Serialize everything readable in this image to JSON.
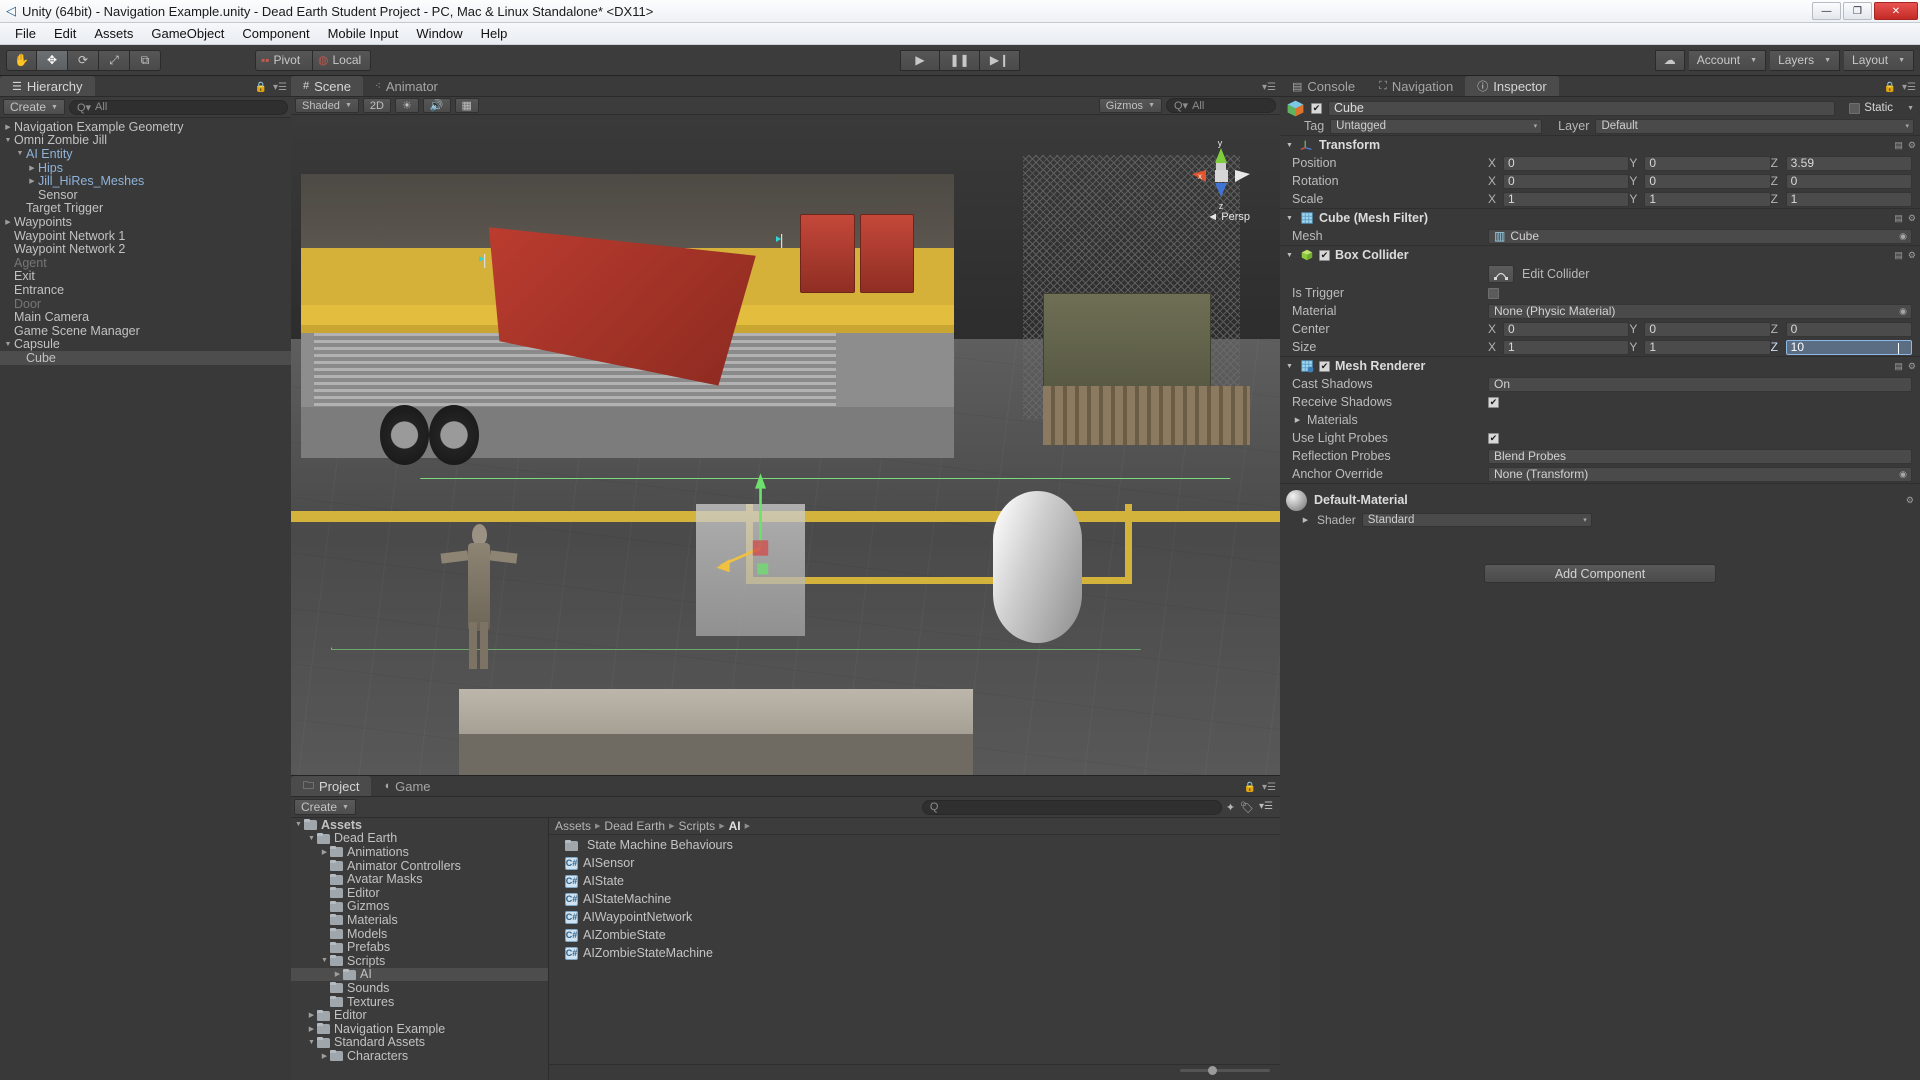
{
  "window": {
    "title": "Unity (64bit) - Navigation Example.unity - Dead Earth Student Project - PC, Mac & Linux Standalone* <DX11>",
    "app_icon": "unity-icon",
    "buttons": {
      "minimize": "—",
      "maximize": "❐",
      "close": "✕"
    }
  },
  "menubar": {
    "items": [
      "File",
      "Edit",
      "Assets",
      "GameObject",
      "Component",
      "Mobile Input",
      "Window",
      "Help"
    ]
  },
  "toolbar": {
    "tools": [
      {
        "name": "hand-tool",
        "glyph": "✋"
      },
      {
        "name": "move-tool",
        "glyph": "✥"
      },
      {
        "name": "rotate-tool",
        "glyph": "⟳"
      },
      {
        "name": "scale-tool",
        "glyph": "⤢"
      },
      {
        "name": "rect-tool",
        "glyph": "⧉"
      }
    ],
    "pivot_label": "Pivot",
    "local_label": "Local",
    "play_label": "▶",
    "pause_label": "❚❚",
    "step_label": "▶❙",
    "cloud_label": "☁",
    "account_label": "Account",
    "layers_label": "Layers",
    "layout_label": "Layout"
  },
  "hierarchy": {
    "tab_label": "Hierarchy",
    "create_label": "Create",
    "search_placeholder": "All",
    "items": [
      {
        "label": "Navigation Example Geometry",
        "depth": 0,
        "arrow": "right",
        "style": "normal"
      },
      {
        "label": "Omni Zombie Jill",
        "depth": 0,
        "arrow": "down",
        "style": "normal"
      },
      {
        "label": "AI Entity",
        "depth": 1,
        "arrow": "down",
        "style": "prefab"
      },
      {
        "label": "Hips",
        "depth": 2,
        "arrow": "right",
        "style": "prefab"
      },
      {
        "label": "Jill_HiRes_Meshes",
        "depth": 2,
        "arrow": "right",
        "style": "prefab"
      },
      {
        "label": "Sensor",
        "depth": 2,
        "arrow": "none",
        "style": "normal"
      },
      {
        "label": "Target Trigger",
        "depth": 1,
        "arrow": "none",
        "style": "normal"
      },
      {
        "label": "Waypoints",
        "depth": 0,
        "arrow": "right",
        "style": "normal"
      },
      {
        "label": "Waypoint Network 1",
        "depth": 0,
        "arrow": "none",
        "style": "normal"
      },
      {
        "label": "Waypoint Network 2",
        "depth": 0,
        "arrow": "none",
        "style": "normal"
      },
      {
        "label": "Agent",
        "depth": 0,
        "arrow": "none",
        "style": "inactive"
      },
      {
        "label": "Exit",
        "depth": 0,
        "arrow": "none",
        "style": "normal"
      },
      {
        "label": "Entrance",
        "depth": 0,
        "arrow": "none",
        "style": "normal"
      },
      {
        "label": "Door",
        "depth": 0,
        "arrow": "none",
        "style": "inactive"
      },
      {
        "label": "Main Camera",
        "depth": 0,
        "arrow": "none",
        "style": "normal"
      },
      {
        "label": "Game Scene Manager",
        "depth": 0,
        "arrow": "none",
        "style": "normal"
      },
      {
        "label": "Capsule",
        "depth": 0,
        "arrow": "down",
        "style": "normal"
      },
      {
        "label": "Cube",
        "depth": 1,
        "arrow": "none",
        "style": "normal",
        "selected": true
      }
    ]
  },
  "scene": {
    "tabs": [
      {
        "label": "Scene",
        "icon": "scene-grid-icon",
        "active": true
      },
      {
        "label": "Animator",
        "icon": "animator-icon",
        "active": false
      }
    ],
    "shading_mode": "Shaded",
    "mode_2d": "2D",
    "light_icon": "☀",
    "audio_icon": "🔊",
    "fx_icon": "▦",
    "gizmos_label": "Gizmos",
    "search_placeholder": "All",
    "view_label": "Persp",
    "axis_labels": {
      "x": "x",
      "y": "y",
      "z": "z"
    }
  },
  "project": {
    "tabs": [
      {
        "label": "Project",
        "icon": "folder-icon",
        "active": true
      },
      {
        "label": "Game",
        "icon": "game-icon",
        "active": false
      }
    ],
    "create_label": "Create",
    "breadcrumb": [
      "Assets",
      "Dead Earth",
      "Scripts",
      "AI"
    ],
    "tree": [
      {
        "label": "Assets",
        "depth": 0,
        "arrow": "down",
        "bold": true
      },
      {
        "label": "Dead Earth",
        "depth": 1,
        "arrow": "down"
      },
      {
        "label": "Animations",
        "depth": 2,
        "arrow": "right"
      },
      {
        "label": "Animator Controllers",
        "depth": 2,
        "arrow": "none"
      },
      {
        "label": "Avatar Masks",
        "depth": 2,
        "arrow": "none"
      },
      {
        "label": "Editor",
        "depth": 2,
        "arrow": "none"
      },
      {
        "label": "Gizmos",
        "depth": 2,
        "arrow": "none"
      },
      {
        "label": "Materials",
        "depth": 2,
        "arrow": "none"
      },
      {
        "label": "Models",
        "depth": 2,
        "arrow": "none"
      },
      {
        "label": "Prefabs",
        "depth": 2,
        "arrow": "none"
      },
      {
        "label": "Scripts",
        "depth": 2,
        "arrow": "down"
      },
      {
        "label": "AI",
        "depth": 3,
        "arrow": "right",
        "selected": true
      },
      {
        "label": "Sounds",
        "depth": 2,
        "arrow": "none"
      },
      {
        "label": "Textures",
        "depth": 2,
        "arrow": "none"
      },
      {
        "label": "Editor",
        "depth": 1,
        "arrow": "right"
      },
      {
        "label": "Navigation Example",
        "depth": 1,
        "arrow": "right"
      },
      {
        "label": "Standard Assets",
        "depth": 1,
        "arrow": "down"
      },
      {
        "label": "Characters",
        "depth": 2,
        "arrow": "right"
      }
    ],
    "assets": [
      {
        "label": "State Machine Behaviours",
        "type": "folder"
      },
      {
        "label": "AISensor",
        "type": "script"
      },
      {
        "label": "AIState",
        "type": "script"
      },
      {
        "label": "AIStateMachine",
        "type": "script"
      },
      {
        "label": "AIWaypointNetwork",
        "type": "script"
      },
      {
        "label": "AIZombieState",
        "type": "script"
      },
      {
        "label": "AIZombieStateMachine",
        "type": "script"
      }
    ]
  },
  "inspector": {
    "tabs": [
      {
        "label": "Console",
        "icon": "console-icon",
        "active": false
      },
      {
        "label": "Navigation",
        "icon": "navigation-icon",
        "active": false
      },
      {
        "label": "Inspector",
        "icon": "info-icon",
        "active": true
      }
    ],
    "static_label": "Static",
    "object_name": "Cube",
    "object_enabled": true,
    "tag_label": "Tag",
    "tag_value": "Untagged",
    "layer_label": "Layer",
    "layer_value": "Default",
    "transform": {
      "title": "Transform",
      "rows": [
        {
          "label": "Position",
          "x": "0",
          "y": "0",
          "z": "3.59"
        },
        {
          "label": "Rotation",
          "x": "0",
          "y": "0",
          "z": "0"
        },
        {
          "label": "Scale",
          "x": "1",
          "y": "1",
          "z": "1"
        }
      ]
    },
    "mesh_filter": {
      "title": "Cube (Mesh Filter)",
      "mesh_label": "Mesh",
      "mesh_value": "Cube"
    },
    "box_collider": {
      "title": "Box Collider",
      "enabled": true,
      "edit_collider_label": "Edit Collider",
      "is_trigger_label": "Is Trigger",
      "is_trigger_value": false,
      "material_label": "Material",
      "material_value": "None (Physic Material)",
      "center": {
        "label": "Center",
        "x": "0",
        "y": "0",
        "z": "0"
      },
      "size": {
        "label": "Size",
        "x": "1",
        "y": "1",
        "z": "10",
        "z_editing": true
      }
    },
    "mesh_renderer": {
      "title": "Mesh Renderer",
      "enabled": true,
      "cast_shadows_label": "Cast Shadows",
      "cast_shadows_value": "On",
      "receive_shadows_label": "Receive Shadows",
      "receive_shadows_value": true,
      "materials_label": "Materials",
      "use_light_probes_label": "Use Light Probes",
      "use_light_probes_value": true,
      "reflection_probes_label": "Reflection Probes",
      "reflection_probes_value": "Blend Probes",
      "anchor_override_label": "Anchor Override",
      "anchor_override_value": "None (Transform)"
    },
    "material_block": {
      "name": "Default-Material",
      "shader_label": "Shader",
      "shader_value": "Standard"
    },
    "add_component_label": "Add Component"
  },
  "colors": {
    "panel_bg": "#383838",
    "edit_field": "#5b6d82",
    "prefab_blue": "#8fb3d9",
    "gizmo_green": "#7fe07f",
    "accent_yellow": "#d4b33c"
  }
}
